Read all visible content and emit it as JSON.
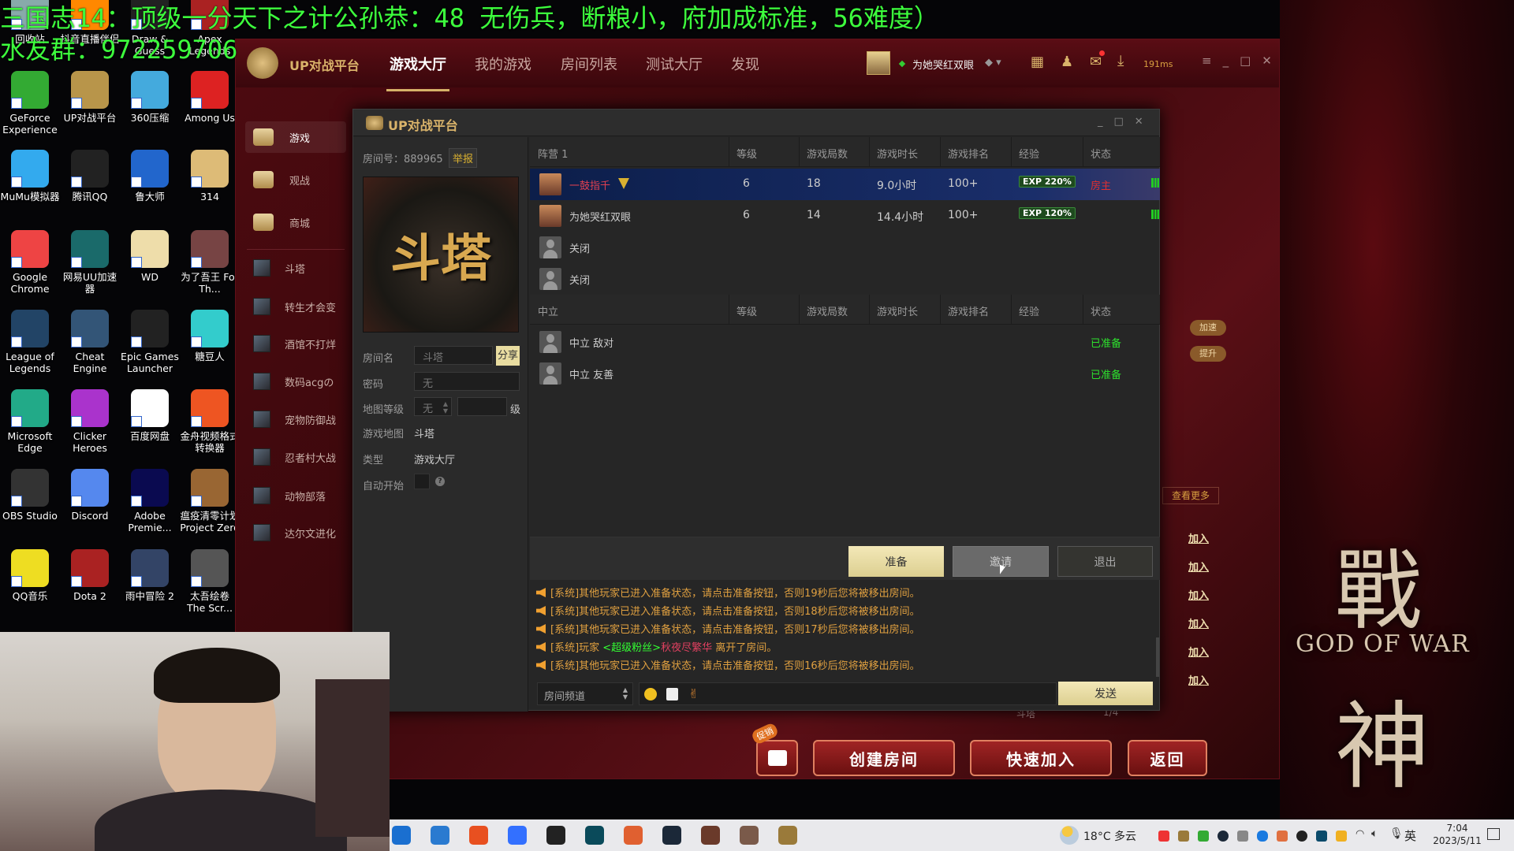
{
  "overlay": {
    "line1": "三国志14：顶级一分天下之计公孙恭：48 无伤兵，断粮小，府加成标准，56难度）",
    "line2": "水友群：972259706"
  },
  "desktop": {
    "icons": [
      {
        "label": "回收站",
        "color": "#8aa"
      },
      {
        "label": "抖音直播伴侣",
        "color": "#f80"
      },
      {
        "label": "Draw & Guess",
        "color": "#222"
      },
      {
        "label": "Apex Legends",
        "color": "#a22"
      },
      {
        "label": "GeForce Experience",
        "color": "#3a3"
      },
      {
        "label": "UP对战平台",
        "color": "#b8954a"
      },
      {
        "label": "360压缩",
        "color": "#4ad"
      },
      {
        "label": "Among Us",
        "color": "#d22"
      },
      {
        "label": "MuMu模拟器",
        "color": "#3ae"
      },
      {
        "label": "腾讯QQ",
        "color": "#222"
      },
      {
        "label": "鲁大师",
        "color": "#26c"
      },
      {
        "label": "314",
        "color": "#db7"
      },
      {
        "label": "Google Chrome",
        "color": "#e44"
      },
      {
        "label": "网易UU加速器",
        "color": "#1a6a6a"
      },
      {
        "label": "WD",
        "color": "#eda"
      },
      {
        "label": "为了吾王 For Th...",
        "color": "#744"
      },
      {
        "label": "League of Legends",
        "color": "#246"
      },
      {
        "label": "Cheat Engine",
        "color": "#357"
      },
      {
        "label": "Epic Games Launcher",
        "color": "#222"
      },
      {
        "label": "糖豆人",
        "color": "#3cc"
      },
      {
        "label": "Microsoft Edge",
        "color": "#2a8"
      },
      {
        "label": "Clicker Heroes",
        "color": "#a3c"
      },
      {
        "label": "百度网盘",
        "color": "#fff"
      },
      {
        "label": "金舟视频格式转换器",
        "color": "#e52"
      },
      {
        "label": "OBS Studio",
        "color": "#333"
      },
      {
        "label": "Discord",
        "color": "#58e"
      },
      {
        "label": "Adobe Premie...",
        "color": "#0a0a50"
      },
      {
        "label": "瘟疫清零计划 Project Zero",
        "color": "#963"
      },
      {
        "label": "QQ音乐",
        "color": "#ed2"
      },
      {
        "label": "Dota 2",
        "color": "#a22"
      },
      {
        "label": "雨中冒险 2",
        "color": "#346"
      },
      {
        "label": "太吾绘卷 The Scr...",
        "color": "#555"
      }
    ]
  },
  "app": {
    "brand": "UP对战平台",
    "tabs": [
      "游戏大厅",
      "我的游戏",
      "房间列表",
      "测试大厅",
      "发现"
    ],
    "active_tab": "游戏大厅",
    "username": "为她哭红双眼",
    "ping": "191ms",
    "sidebar": {
      "main": [
        {
          "label": "游戏",
          "icon": "gamepad-icon"
        },
        {
          "label": "观战",
          "icon": "tv-play-icon"
        },
        {
          "label": "商城",
          "icon": "store-icon"
        }
      ],
      "games": [
        "斗塔",
        "转生才会变",
        "酒馆不打烊",
        "数码acgの",
        "宠物防御战",
        "忍者村大战",
        "动物部落",
        "达尔文进化"
      ]
    },
    "right_panel": {
      "boost": "加速",
      "upgrade": "提升",
      "see_more": "查看更多",
      "join": "加入",
      "last_row": {
        "name": "斗塔",
        "count": "1/4"
      }
    },
    "bottom": {
      "promo_badge": "促销",
      "create": "创建房间",
      "quick_join": "快速加入",
      "back": "返回"
    }
  },
  "dialog": {
    "title": "UP对战平台",
    "room_no_label": "房间号：",
    "room_no": "889965",
    "report": "举报",
    "cover_text": "斗塔",
    "fields": {
      "room_name_label": "房间名",
      "room_name": "斗塔",
      "share": "分享",
      "password_label": "密码",
      "password": "无",
      "map_level_label": "地图等级",
      "map_level": "无",
      "map_level_unit": "级",
      "game_map_label": "游戏地图",
      "game_map": "斗塔",
      "type_label": "类型",
      "type": "游戏大厅",
      "auto_start_label": "自动开始"
    },
    "columns": [
      "等级",
      "游戏局数",
      "游戏时长",
      "游戏排名",
      "经验",
      "状态"
    ],
    "team1": {
      "name": "阵营 1",
      "players": [
        {
          "name": "一鼓指千",
          "level": "6",
          "games": "18",
          "time": "9.0小时",
          "rank": "100+",
          "exp": "EXP 220%",
          "status": "房主",
          "highlight": true
        },
        {
          "name": "为她哭红双眼",
          "level": "6",
          "games": "14",
          "time": "14.4小时",
          "rank": "100+",
          "exp": "EXP 120%",
          "status": ""
        },
        {
          "name": "关闭"
        },
        {
          "name": "关闭"
        }
      ]
    },
    "neutral": {
      "name": "中立",
      "players": [
        {
          "name": "中立 敌对",
          "status": "已准备"
        },
        {
          "name": "中立 友善",
          "status": "已准备"
        }
      ]
    },
    "buttons": {
      "ready": "准备",
      "invite": "邀请",
      "exit": "退出"
    },
    "chat": [
      {
        "prefix": "[系统]其他玩家已进入准备状态，请点击准备按钮，否则19秒后您将被移出房间。"
      },
      {
        "prefix": "[系统]其他玩家已进入准备状态，请点击准备按钮，否则18秒后您将被移出房间。"
      },
      {
        "prefix": "[系统]其他玩家已进入准备状态，请点击准备按钮，否则17秒后您将被移出房间。"
      },
      {
        "prefix": "[系统]玩家 ",
        "tag": "<超级粉丝>",
        "user": "秋夜尽繁华",
        "suffix": " 离开了房间。"
      },
      {
        "prefix": "[系统]其他玩家已进入准备状态，请点击准备按钮，否则16秒后您将被移出房间。"
      }
    ],
    "channel": "房间频道",
    "send": "发送"
  },
  "background": {
    "title": "GOD OF WAR",
    "glyph1": "戰",
    "glyph2": "神"
  },
  "taskbar": {
    "weather": "18°C 多云",
    "ime": "英",
    "time": "7:04",
    "date": "2023/5/11",
    "apps": [
      {
        "icon": "windows-start-icon",
        "color": "#1a6fd0"
      },
      {
        "icon": "mail-icon",
        "color": "#2a7ad0"
      },
      {
        "icon": "media-player-icon",
        "color": "#e85020"
      },
      {
        "icon": "feishu-icon",
        "color": "#3370ff"
      },
      {
        "icon": "netease-icon",
        "color": "#222"
      },
      {
        "icon": "uu-icon",
        "color": "#0a4a5a"
      },
      {
        "icon": "browser-icon",
        "color": "#e06030"
      },
      {
        "icon": "steam-icon",
        "color": "#1b2838"
      },
      {
        "icon": "three-kingdoms-icon",
        "color": "#6a3a2a"
      },
      {
        "icon": "avatar-app-icon",
        "color": "#7a5a4a"
      },
      {
        "icon": "up-platform-icon",
        "color": "#9a7a3a"
      }
    ]
  }
}
